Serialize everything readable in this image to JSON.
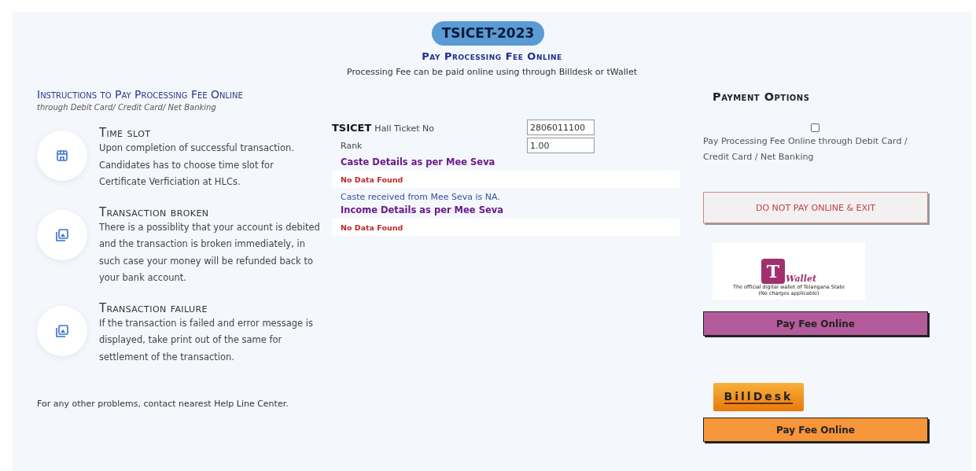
{
  "header": {
    "badge": "TSICET-2023",
    "title": "Pay Processing Fee Online",
    "subtitle": "Processing Fee can be paid online using through Billdesk or tWallet"
  },
  "instructions": {
    "title": "Instructions to Pay Processing Fee Online",
    "subtitle": "through Debit Card/ Credit Card/ Net Banking",
    "items": [
      {
        "kind": "store",
        "heading": "Time slot",
        "text": "Upon completion of successful transaction. Candidates has to choose time slot for Certificate Verficiation at HLCs."
      },
      {
        "kind": "image",
        "heading": "Transaction broken",
        "text": "There is a possiblity that your account is debited and the transaction is broken immediately, in such case your money will be refunded back to your bank account."
      },
      {
        "kind": "image",
        "heading": "Transaction failure",
        "text": "If the transaction is failed and error message is displayed, take print out of the same for settlement of the transaction."
      }
    ],
    "footer": "For any other problems, contact nearest Help Line Center."
  },
  "details": {
    "hall_ticket": {
      "prefix": "TSICET",
      "label": "Hall Ticket No",
      "value": "2806011100"
    },
    "rank": {
      "label": "Rank",
      "value": "1.00"
    },
    "caste": {
      "heading": "Caste Details as per Mee Seva",
      "result": "No Data Found",
      "note": "Caste received from Mee Seva is NA."
    },
    "income": {
      "heading": "Income Details as per Mee Seva",
      "result": "No Data Found"
    }
  },
  "payment": {
    "title": "Payment Options",
    "online_checkbox": {
      "checked": false,
      "label": "Pay Processing Fee Online through Debit Card / Credit Card / Net Banking"
    },
    "exit_button": "DO NOT PAY ONLINE & EXIT",
    "twallet": {
      "logo_letter": "T",
      "logo_word": "Wallet",
      "caption": "The official digital wallet of Telangana State",
      "note": "(No charges applicable)",
      "button": "Pay Fee Online"
    },
    "billdesk": {
      "logo_word": "BillDesk",
      "button": "Pay Fee Online"
    }
  }
}
